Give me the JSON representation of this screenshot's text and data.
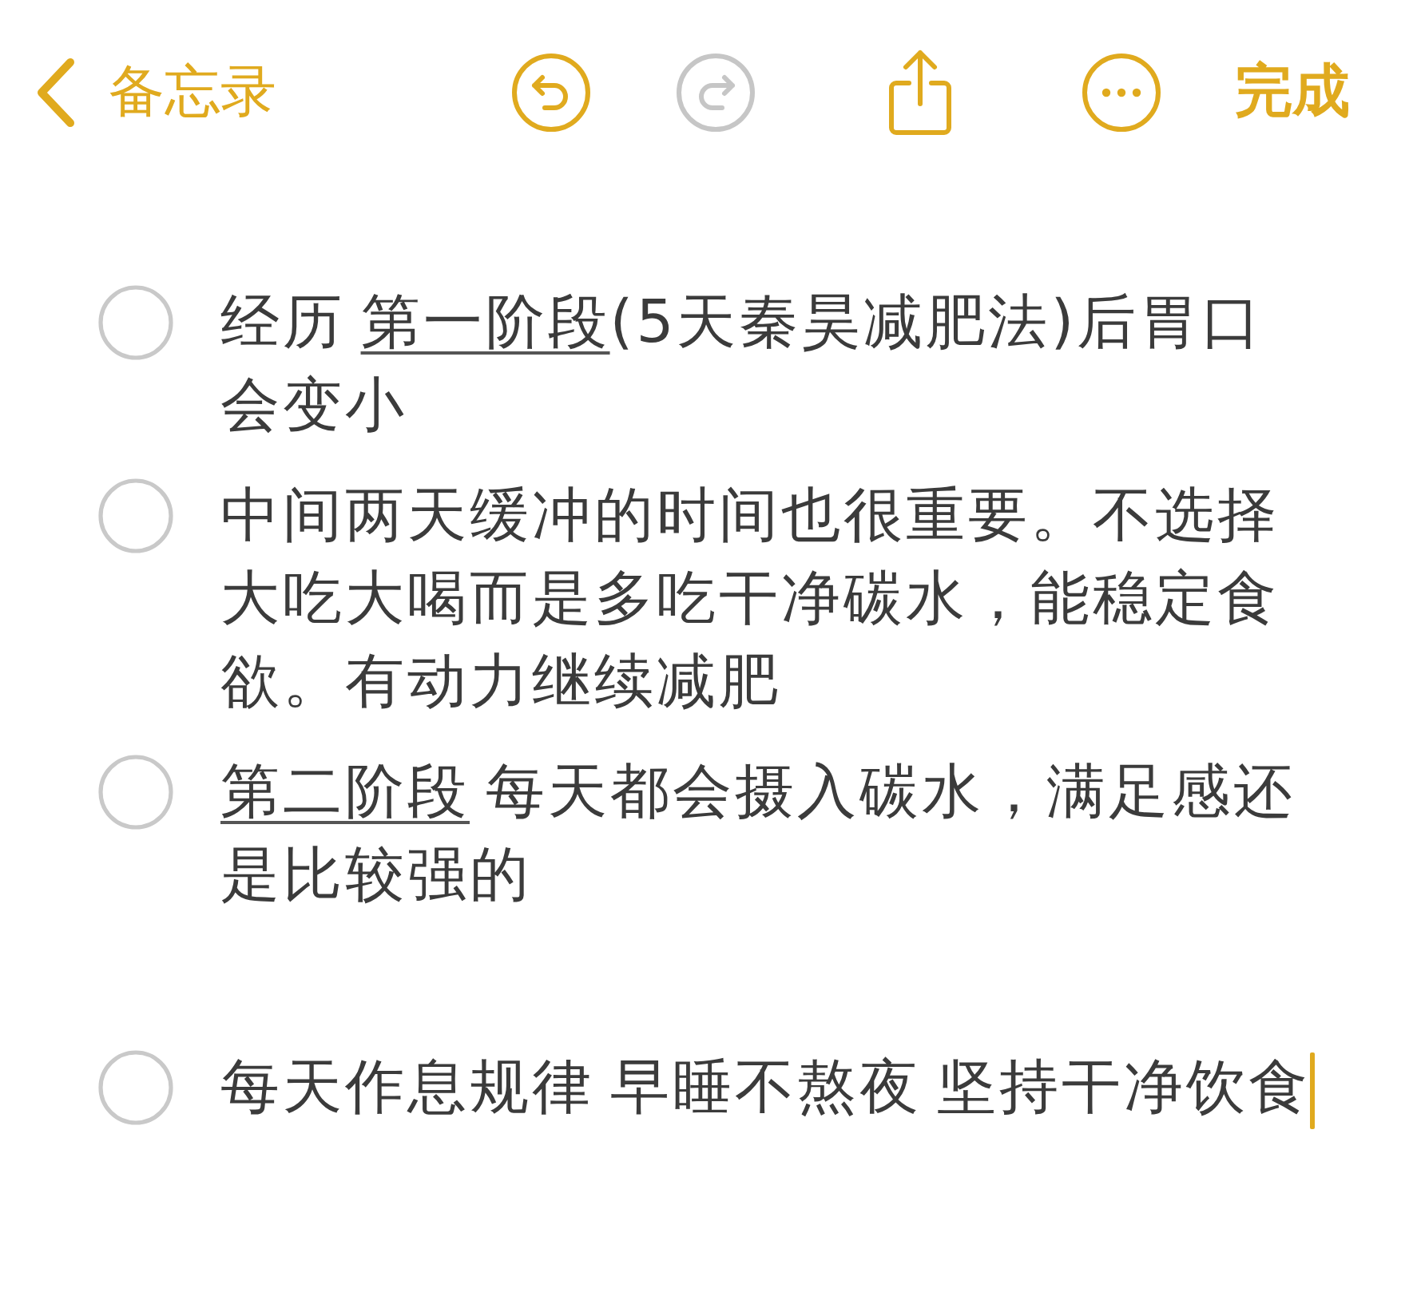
{
  "toolbar": {
    "back": {
      "label": "备忘录"
    },
    "undo": {
      "disabled": false
    },
    "redo": {
      "disabled": true
    },
    "done": {
      "label": "完成"
    }
  },
  "sections": [
    {
      "items": [
        {
          "checked": false,
          "cursor": false,
          "segments": [
            {
              "text": "经历 ",
              "underlined": false
            },
            {
              "text": "第一阶段",
              "underlined": true
            },
            {
              "text": "(5天秦昊减肥法)后胃口会变小",
              "underlined": false
            }
          ]
        },
        {
          "checked": false,
          "cursor": false,
          "segments": [
            {
              "text": "中间两天缓冲的时间也很重要。不选择大吃大喝而是多吃干净碳水，能稳定食欲。有动力继续减肥",
              "underlined": false
            }
          ]
        },
        {
          "checked": false,
          "cursor": false,
          "segments": [
            {
              "text": "第二阶段",
              "underlined": true
            },
            {
              "text": " 每天都会摄入碳水，满足感还是比较强的",
              "underlined": false
            }
          ]
        }
      ]
    },
    {
      "items": [
        {
          "checked": false,
          "cursor": true,
          "segments": [
            {
              "text": "每天作息规律 早睡不熬夜 坚持干净饮食",
              "underlined": false
            }
          ]
        }
      ]
    }
  ]
}
